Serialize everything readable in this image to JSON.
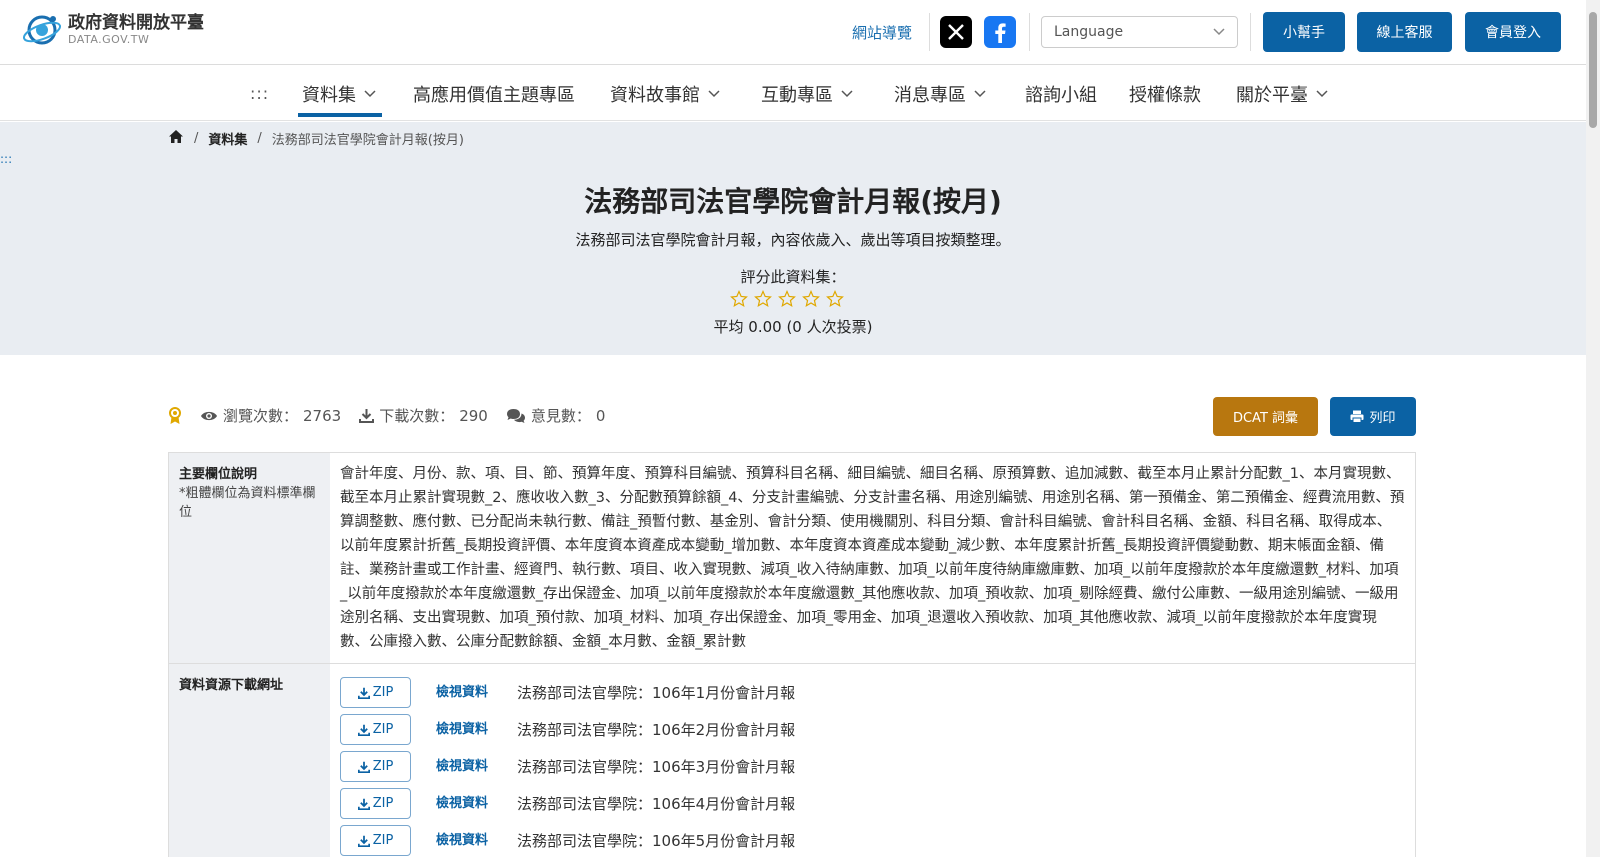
{
  "header": {
    "logo_title": "政府資料開放平臺",
    "logo_sub": "DATA.GOV.TW",
    "sitemap": "網站導覽",
    "language_placeholder": "Language",
    "buttons": {
      "helper": "小幫手",
      "service": "線上客服",
      "login": "會員登入"
    }
  },
  "nav": {
    "dots": ":::",
    "items": [
      "資料集",
      "高應用價值主題專區",
      "資料故事館",
      "互動專區",
      "消息專區",
      "諮詢小組",
      "授權條款",
      "關於平臺"
    ]
  },
  "breadcrumb": {
    "dataset": "資料集",
    "current": "法務部司法官學院會計月報(按月)"
  },
  "side_dots": ":::",
  "hero": {
    "title": "法務部司法官學院會計月報(按月)",
    "description": "法務部司法官學院會計月報，內容依歲入、歲出等項目按類整理。",
    "rate_label": "評分此資料集：",
    "stars": 0,
    "average": "平均 0.00 (0 人次投票)"
  },
  "stats": {
    "views_label": "瀏覽次數：",
    "views": "2763",
    "downloads_label": "下載次數：",
    "downloads": "290",
    "comments_label": "意見數：",
    "comments": "0"
  },
  "actions": {
    "dcat": "DCAT 詞彙",
    "print": "列印"
  },
  "table": {
    "fields_header": "主要欄位說明",
    "fields_note": "*粗體欄位為資料標準欄位",
    "fields_text": "會計年度、月份、款、項、目、節、預算年度、預算科目編號、預算科目名稱、細目編號、細目名稱、原預算數、追加減數、截至本月止累計分配數_1、本月實現數、截至本月止累計實現數_2、應收收入數_3、分配數預算餘額_4、分支計畫編號、分支計畫名稱、用途別編號、用途別名稱、第一預備金、第二預備金、經費流用數、預算調整數、應付數、已分配尚未執行數、備註_預暫付數、基金別、會計分類、使用機關別、科目分類、會計科目編號、會計科目名稱、金額、科目名稱、取得成本、以前年度累計折舊_長期投資評價、本年度資本資產成本變動_增加數、本年度資本資產成本變動_減少數、本年度累計折舊_長期投資評價變動數、期末帳面金額、備註、業務計畫或工作計畫、經資門、執行數、項目、收入實現數、減項_收入待納庫數、加項_以前年度待納庫繳庫數、加項_以前年度撥款於本年度繳還數_材料、加項_以前年度撥款於本年度繳還數_存出保證金、加項_以前年度撥款於本年度繳還數_其他應收款、加項_預收款、加項_剔除經費、繳付公庫數、一級用途別編號、一級用途別名稱、支出實現數、加項_預付款、加項_材料、加項_存出保證金、加項_零用金、加項_退還收入預收款、加項_其他應收款、減項_以前年度撥款於本年度實現數、公庫撥入數、公庫分配數餘額、金額_本月數、金額_累計數",
    "resources_header": "資料資源下載網址",
    "zip_label": "ZIP",
    "view_label": "檢視資料",
    "resources": [
      "法務部司法官學院：106年1月份會計月報",
      "法務部司法官學院：106年2月份會計月報",
      "法務部司法官學院：106年3月份會計月報",
      "法務部司法官學院：106年4月份會計月報",
      "法務部司法官學院：106年5月份會計月報"
    ]
  },
  "colors": {
    "primary": "#0b62a4",
    "dcat": "#b8770f",
    "hero_bg": "#e9edf2",
    "star": "#e0a800"
  }
}
